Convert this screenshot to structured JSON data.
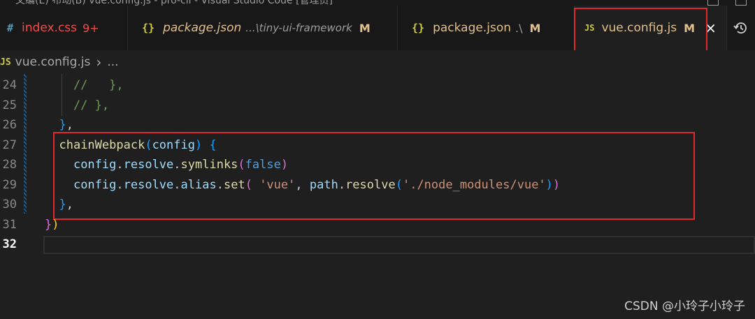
{
  "titlebar": {
    "text": "文编(E)   布动(B)    vue.config.js - pro-cli - Visual Studio Code [管理员]"
  },
  "tabs": [
    {
      "icon": "#",
      "name": "index.css",
      "desc": "",
      "badge": "9+",
      "mod": "",
      "name_color": "#f14c4c",
      "icon_color": "#519aba",
      "badge_color": "#f14c4c"
    },
    {
      "icon": "{}",
      "name": "package.json",
      "desc": "...\\tiny-ui-framework",
      "badge": "",
      "mod": "M",
      "name_color": "#e2c08d",
      "icon_color": "#cbcb41",
      "italic": true
    },
    {
      "icon": "{}",
      "name": "package.json",
      "desc": ".\\",
      "badge": "",
      "mod": "M",
      "name_color": "#e2c08d",
      "icon_color": "#cbcb41"
    },
    {
      "icon": "JS",
      "name": "vue.config.js",
      "desc": "",
      "badge": "",
      "mod": "M",
      "name_color": "#e2c08d",
      "icon_color": "#cbcb41",
      "close": "×"
    }
  ],
  "breadcrumb": {
    "icon": "JS",
    "file": "vue.config.js",
    "sep": "›",
    "rest": "..."
  },
  "editor": {
    "lines": [
      {
        "n": "24",
        "tokens": [
          [
            "    //   },",
            "#6a9955"
          ]
        ]
      },
      {
        "n": "25",
        "tokens": [
          [
            "    // },",
            "#6a9955"
          ]
        ]
      },
      {
        "n": "26",
        "tokens": [
          [
            "  ",
            "#cccccc"
          ],
          [
            "}",
            "#179fff"
          ],
          [
            ",",
            "#cccccc"
          ]
        ]
      },
      {
        "n": "27",
        "tokens": [
          [
            "  ",
            "#cccccc"
          ],
          [
            "chainWebpack",
            "#dcdcaa"
          ],
          [
            "(",
            "#179fff"
          ],
          [
            "config",
            "#9cdcfe"
          ],
          [
            ")",
            "#179fff"
          ],
          [
            " ",
            "#cccccc"
          ],
          [
            "{",
            "#179fff"
          ]
        ]
      },
      {
        "n": "28",
        "tokens": [
          [
            "    ",
            "#cccccc"
          ],
          [
            "config",
            "#9cdcfe"
          ],
          [
            ".",
            "#cccccc"
          ],
          [
            "resolve",
            "#9cdcfe"
          ],
          [
            ".",
            "#cccccc"
          ],
          [
            "symlinks",
            "#dcdcaa"
          ],
          [
            "(",
            "#da70d6"
          ],
          [
            "false",
            "#569cd6"
          ],
          [
            ")",
            "#da70d6"
          ]
        ]
      },
      {
        "n": "29",
        "tokens": [
          [
            "    ",
            "#cccccc"
          ],
          [
            "config",
            "#9cdcfe"
          ],
          [
            ".",
            "#cccccc"
          ],
          [
            "resolve",
            "#9cdcfe"
          ],
          [
            ".",
            "#cccccc"
          ],
          [
            "alias",
            "#9cdcfe"
          ],
          [
            ".",
            "#cccccc"
          ],
          [
            "set",
            "#dcdcaa"
          ],
          [
            "(",
            "#da70d6"
          ],
          [
            " ",
            "#cccccc"
          ],
          [
            "'vue'",
            "#ce9178"
          ],
          [
            ", ",
            "#cccccc"
          ],
          [
            "path",
            "#9cdcfe"
          ],
          [
            ".",
            "#cccccc"
          ],
          [
            "resolve",
            "#dcdcaa"
          ],
          [
            "(",
            "#179fff"
          ],
          [
            "'./node_modules/vue'",
            "#ce9178"
          ],
          [
            ")",
            "#179fff"
          ],
          [
            ")",
            "#da70d6"
          ]
        ]
      },
      {
        "n": "30",
        "tokens": [
          [
            "  ",
            "#cccccc"
          ],
          [
            "}",
            "#179fff"
          ],
          [
            ",",
            "#cccccc"
          ]
        ]
      },
      {
        "n": "31",
        "tokens": [
          [
            "}",
            "#da70d6"
          ],
          [
            ")",
            "#ffd700"
          ]
        ]
      },
      {
        "n": "32",
        "tokens": []
      }
    ],
    "current_line": "32"
  },
  "watermark": "CSDN @小玲子小玲子",
  "colors": {
    "highlight_box": "#e3282d"
  }
}
